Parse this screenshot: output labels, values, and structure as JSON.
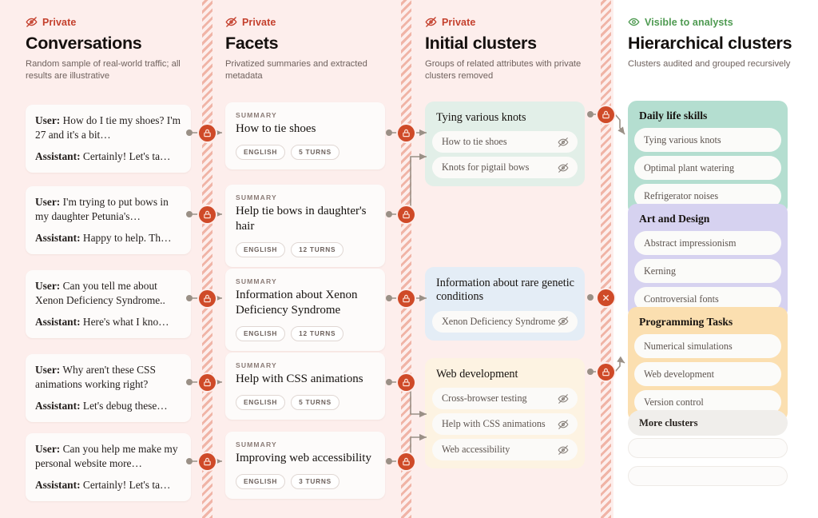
{
  "columns": [
    {
      "privacy_label": "Private",
      "privacy_icon": "eye-off-icon",
      "title": "Conversations",
      "subtitle": "Random sample of real-world traffic; all results are illustrative"
    },
    {
      "privacy_label": "Private",
      "privacy_icon": "eye-off-icon",
      "title": "Facets",
      "subtitle": "Privatized summaries and extracted metadata"
    },
    {
      "privacy_label": "Private",
      "privacy_icon": "eye-off-icon",
      "title": "Initial clusters",
      "subtitle": "Groups of related attributes with private clusters removed"
    },
    {
      "privacy_label": "Visible to analysts",
      "privacy_icon": "eye-icon",
      "title": "Hierarchical clusters",
      "subtitle": "Clusters audited and grouped recursively"
    }
  ],
  "conversations": [
    {
      "user_prefix": "User:",
      "user_text": "How do I tie my shoes? I'm 27 and it's a bit…",
      "assistant_prefix": "Assistant:",
      "assistant_text": "Certainly! Let's ta…"
    },
    {
      "user_prefix": "User:",
      "user_text": "I'm trying to put bows in my daughter Petunia's…",
      "assistant_prefix": "Assistant:",
      "assistant_text": "Happy to help. Th…"
    },
    {
      "user_prefix": "User:",
      "user_text": "Can you tell me about Xenon Deficiency Syndrome..",
      "assistant_prefix": "Assistant:",
      "assistant_text": "Here's what I kno…"
    },
    {
      "user_prefix": "User:",
      "user_text": "Why aren't these CSS animations working right?",
      "assistant_prefix": "Assistant:",
      "assistant_text": "Let's debug these…"
    },
    {
      "user_prefix": "User:",
      "user_text": "Can you help me make my personal website more…",
      "assistant_prefix": "Assistant:",
      "assistant_text": "Certainly! Let's ta…"
    }
  ],
  "facets": [
    {
      "label": "SUMMARY",
      "title": "How to tie shoes",
      "tags": [
        "ENGLISH",
        "5 TURNS"
      ]
    },
    {
      "label": "SUMMARY",
      "title": "Help tie bows in daughter's hair",
      "tags": [
        "ENGLISH",
        "12 TURNS"
      ]
    },
    {
      "label": "SUMMARY",
      "title": "Information about Xenon Deficiency Syndrome",
      "tags": [
        "ENGLISH",
        "12 TURNS"
      ]
    },
    {
      "label": "SUMMARY",
      "title": "Help with CSS animations",
      "tags": [
        "ENGLISH",
        "5 TURNS"
      ]
    },
    {
      "label": "SUMMARY",
      "title": "Improving web accessibility",
      "tags": [
        "ENGLISH",
        "3 TURNS"
      ]
    }
  ],
  "initial_clusters": [
    {
      "title": "Tying various knots",
      "tone": "green",
      "items": [
        "How to tie shoes",
        "Knots for pigtail bows"
      ]
    },
    {
      "title": "Information about rare genetic conditions",
      "tone": "blue",
      "items": [
        "Xenon Deficiency Syndrome"
      ]
    },
    {
      "title": "Web development",
      "tone": "yellow",
      "items": [
        "Cross-browser testing",
        "Help with CSS animations",
        "Web accessibility"
      ]
    }
  ],
  "hierarchical_clusters": [
    {
      "title": "Daily life skills",
      "tone": "green",
      "items": [
        "Tying various knots",
        "Optimal plant watering",
        "Refrigerator noises"
      ]
    },
    {
      "title": "Art and Design",
      "tone": "purple",
      "items": [
        "Abstract impressionism",
        "Kerning",
        "Controversial fonts"
      ]
    },
    {
      "title": "Programming Tasks",
      "tone": "orange",
      "items": [
        "Numerical simulations",
        "Web development",
        "Version control"
      ]
    }
  ],
  "more_clusters_label": "More clusters",
  "badges": {
    "lock_icon": "lock-icon",
    "cross_icon": "close-icon"
  },
  "colors": {
    "private_accent": "#c4402d",
    "public_accent": "#4e9a51",
    "badge_red": "#cf4a28",
    "page_bg_private": "#fdeeec",
    "page_bg_public": "#ffffff",
    "cluster_green": "#e2efe8",
    "cluster_blue": "#e4edf6",
    "cluster_yellow": "#fdf3e2",
    "hier_green": "#b4ded0",
    "hier_purple": "#d6d2f0",
    "hier_orange": "#fbdfb0"
  }
}
